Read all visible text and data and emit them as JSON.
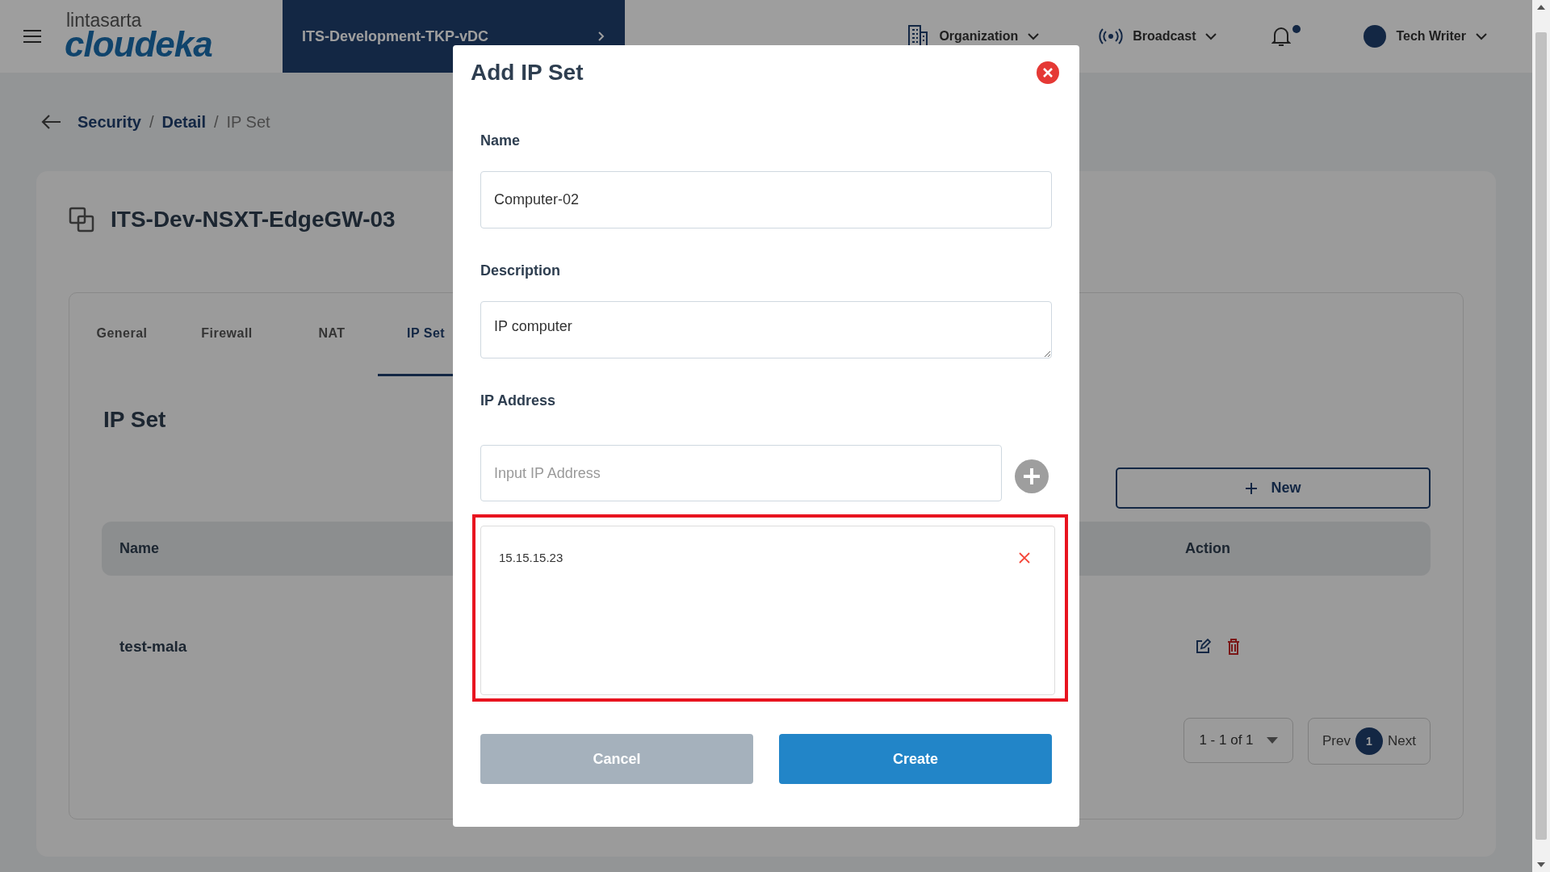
{
  "header": {
    "logo_top": "lintasarta",
    "logo_main": "cloudeka",
    "project": "ITS-Development-TKP-vDC",
    "nav": [
      {
        "label": "Organization",
        "kind": "organization"
      },
      {
        "label": "Broadcast",
        "kind": "broadcast"
      }
    ],
    "notifications_unread": true,
    "user": "Tech Writer"
  },
  "breadcrumb": [
    {
      "label": "Security",
      "current": false
    },
    {
      "separator": "/",
      "label": "Detail",
      "current": false
    },
    {
      "separator": "/",
      "label": "IP Set",
      "current": true
    }
  ],
  "page_title": "ITS-Dev-NSXT-EdgeGW-03",
  "tabs": [
    {
      "label": "General",
      "selected": false
    },
    {
      "label": "Firewall",
      "selected": false
    },
    {
      "label": "NAT",
      "selected": false
    },
    {
      "label": "IP Set",
      "selected": true
    }
  ],
  "section_title": "IP Set",
  "new_button": "New",
  "table": {
    "columns": [
      "Name",
      "Action"
    ],
    "rows": [
      {
        "name": "test-mala"
      }
    ]
  },
  "pagination": {
    "range": "1 - 1 of 1",
    "prev": "Prev",
    "page": "1",
    "next": "Next"
  },
  "modal": {
    "title": "Add IP Set",
    "name_label": "Name",
    "name_value": "Computer-02",
    "description_label": "Description",
    "description_value": "IP computer",
    "ip_label": "IP Address",
    "ip_placeholder": "Input IP Address",
    "ip_list": [
      "15.15.15.23"
    ],
    "cancel": "Cancel",
    "create": "Create"
  }
}
